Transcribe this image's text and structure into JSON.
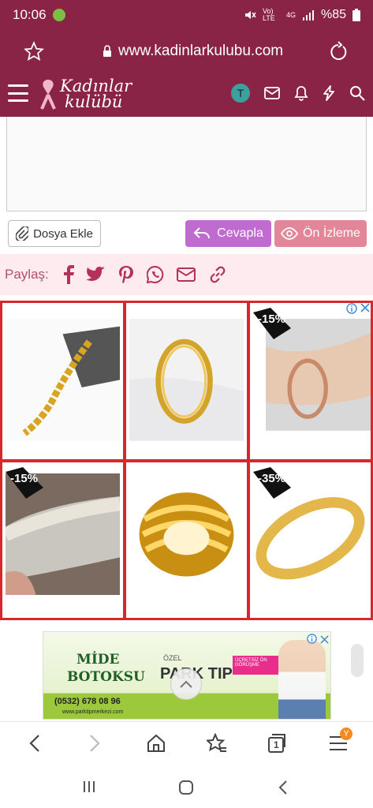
{
  "status": {
    "time": "10:06",
    "network": "Vo) LTE",
    "signal": "4G",
    "battery": "%85"
  },
  "browser": {
    "url": "www.kadinlarkulubu.com"
  },
  "site": {
    "logo_line1": "Kadınlar",
    "logo_line2": "kulübü",
    "avatar_letter": "T"
  },
  "reply": {
    "attach_label": "Dosya Ekle",
    "reply_label": "Cevapla",
    "preview_label": "Ön İzleme"
  },
  "share": {
    "label": "Paylaş:"
  },
  "ads": {
    "products": [
      {
        "discount": ""
      },
      {
        "discount": ""
      },
      {
        "discount": "-15%"
      },
      {
        "discount": "-15%"
      },
      {
        "discount": ""
      },
      {
        "discount": "-35%"
      }
    ]
  },
  "banner": {
    "line1": "MİDE",
    "line2": "BOTOKSU",
    "brand": "PARK TIP",
    "ozel": "ÖZEL",
    "phone": "(0532) 678 08 96",
    "web": "www.parktipmerkezi.com",
    "promo": "ÜCRETSİZ ÖN GÖRÜŞME"
  },
  "nav": {
    "tabs_count": "1",
    "menu_badge": "Y"
  },
  "colors": {
    "brand": "#8a2447",
    "ad_border": "#d8282b",
    "reply_button": "#c06bd0",
    "preview_button": "#e48699"
  }
}
